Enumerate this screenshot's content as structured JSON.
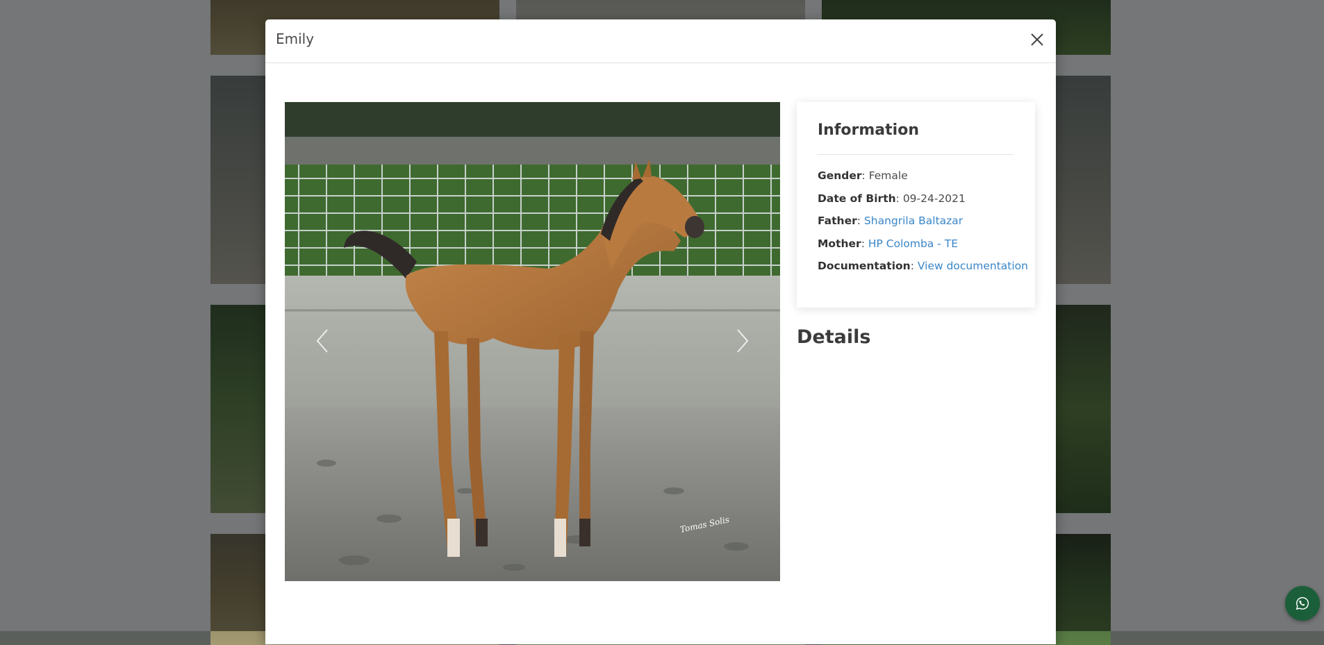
{
  "modal": {
    "title": "Emily",
    "close_icon": "close-icon"
  },
  "carousel": {
    "prev_icon": "chevron-left-icon",
    "next_icon": "chevron-right-icon",
    "photo_watermark": "Tomas Solis"
  },
  "info": {
    "title": "Information",
    "rows": [
      {
        "label": "Gender",
        "value": "Female",
        "link": false
      },
      {
        "label": "Date of Birth",
        "value": "09-24-2021",
        "link": false
      },
      {
        "label": "Father",
        "value": "Shangrila Baltazar",
        "link": true
      },
      {
        "label": "Mother",
        "value": "HP Colomba - TE",
        "link": true
      },
      {
        "label": "Documentation",
        "value": "View documentation",
        "link": true
      }
    ]
  },
  "details": {
    "heading": "Details"
  },
  "whatsapp": {
    "icon": "whatsapp-icon",
    "color": "#1b5e3a"
  },
  "colors": {
    "link": "#3a86c8",
    "overlay": "rgba(0,0,0,0.5)"
  }
}
